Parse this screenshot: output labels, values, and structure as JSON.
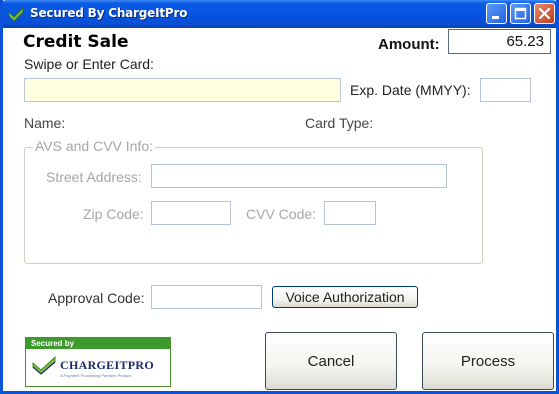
{
  "window": {
    "title": "Secured By ChargeItPro",
    "icon": "chargeitpro-check-icon",
    "controls": [
      "minimize-icon",
      "maximize-icon",
      "close-icon"
    ]
  },
  "form": {
    "heading": "Credit Sale",
    "amount_label": "Amount:",
    "amount_value": "65.23",
    "card_label": "Swipe or Enter Card:",
    "card_value": "",
    "exp_label": "Exp. Date (MMYY):",
    "exp_value": "",
    "name_label": "Name:",
    "card_type_label": "Card Type:",
    "avs_group": {
      "legend": "AVS and CVV Info:",
      "street_label": "Street Address:",
      "street_value": "",
      "zip_label": "Zip Code:",
      "zip_value": "",
      "cvv_label": "CVV Code:",
      "cvv_value": ""
    },
    "approval_label": "Approval Code:",
    "approval_value": "",
    "voice_button": "Voice Authorization",
    "cancel_button": "Cancel",
    "process_button": "Process"
  },
  "logo": {
    "secured_by": "Secured by",
    "brand": "CHARGEITPRO",
    "tagline": "A Payment Processing Partners Product"
  },
  "colors": {
    "titlebar": "#0754e0",
    "card_input_bg": "#ffffe0",
    "logo_green": "#3e9a2c"
  }
}
